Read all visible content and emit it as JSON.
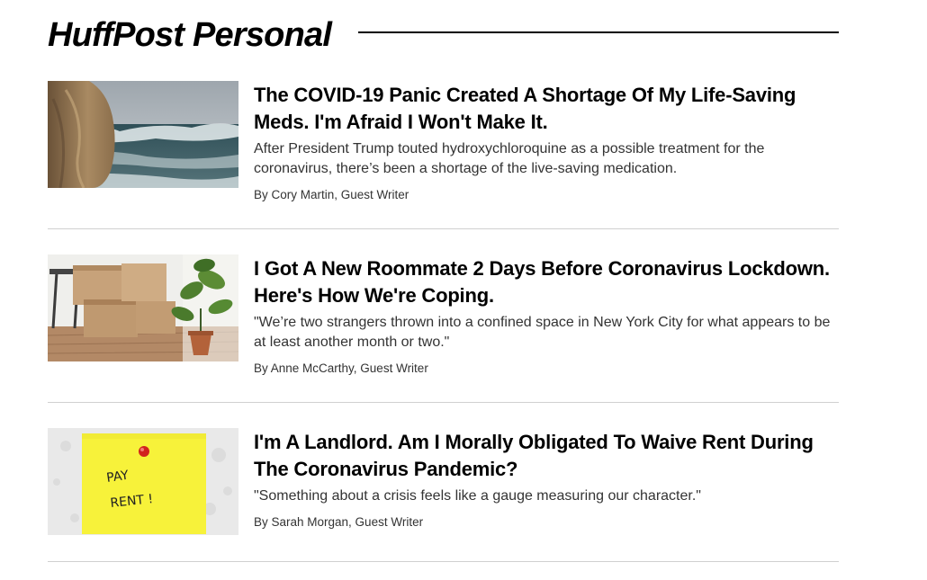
{
  "section": {
    "title": "HuffPost Personal"
  },
  "articles": [
    {
      "headline": "The COVID-19 Panic Created A Shortage Of My Life-Saving Meds. I'm Afraid I Won't Make It.",
      "dek": "After President Trump touted hydroxychloroquine as a possible treatment for the coronavirus, there’s been a shortage of the live-saving medication.",
      "byline": "By Cory Martin, Guest Writer",
      "image": "woman-looking-at-ocean-waves"
    },
    {
      "headline": "I Got A New Roommate 2 Days Before Coronavirus Lockdown. Here's How We're Coping.",
      "dek": "\"We’re two strangers thrown into a confined space in New York City for what appears to be at least another month or two.\"",
      "byline": "By Anne McCarthy, Guest Writer",
      "image": "moving-boxes-and-houseplant"
    },
    {
      "headline": "I'm A Landlord. Am I Morally Obligated To Waive Rent During The Coronavirus Pandemic?",
      "dek": "\"Something about a crisis feels like a gauge measuring our character.\"",
      "byline": "By Sarah Morgan, Guest Writer",
      "image": "pay-rent-sticky-note",
      "image_text": {
        "line1": "PAY",
        "line2": "RENT !"
      }
    }
  ]
}
